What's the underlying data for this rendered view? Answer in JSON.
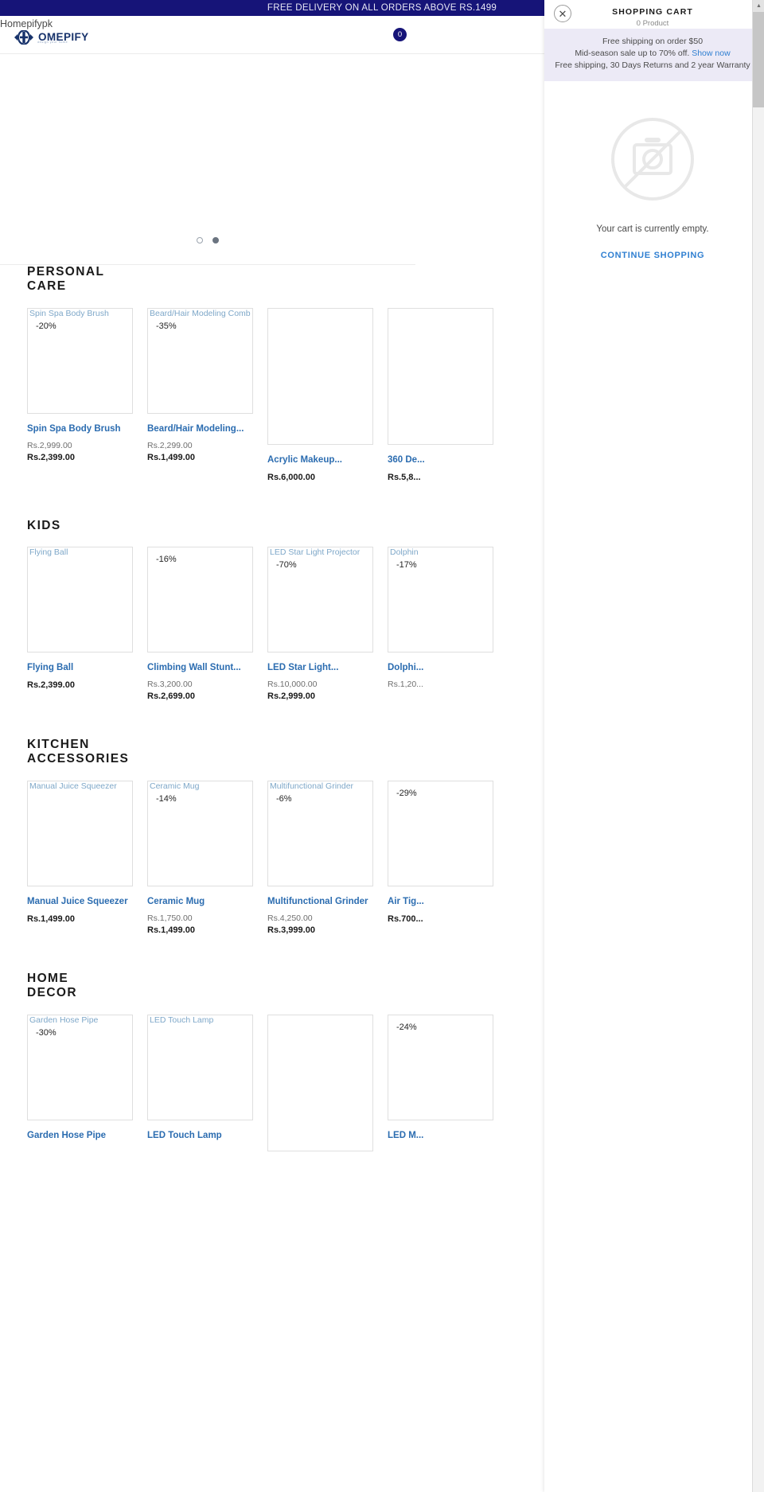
{
  "announcement": {
    "text": "FREE DELIVERY ON ALL ORDERS ABOVE RS.1499"
  },
  "header": {
    "brand_alt_text": "Homepifypk",
    "logo_word": "OMEPIFY",
    "logo_tagline": "design your home",
    "cart_count": "0"
  },
  "cart": {
    "title": "SHOPPING CART",
    "product_count": "0 Product",
    "close_icon": "close-icon",
    "promo_line1": "Free shipping on order  $50",
    "promo_line2_prefix": "Mid-season sale up to 70% off. ",
    "promo_link": "Show now",
    "promo_line3": "Free shipping, 30 Days Returns and 2 year Warranty",
    "empty_text": "Your cart is currently empty.",
    "continue_label": "CONTINUE SHOPPING"
  },
  "collections": [
    {
      "title": "PERSONAL CARE",
      "products": [
        {
          "alt": "Spin Spa Body Brush",
          "discount": "-20%",
          "title": "Spin Spa Body Brush",
          "old_price": "Rs.2,999.00",
          "price": "Rs.2,399.00",
          "tall": false
        },
        {
          "alt": "Beard/Hair Modeling Comb",
          "discount": "-35%",
          "title": "Beard/Hair Modeling...",
          "old_price": "Rs.2,299.00",
          "price": "Rs.1,499.00",
          "tall": false
        },
        {
          "alt": "",
          "discount": "",
          "title": "Acrylic Makeup...",
          "old_price": "",
          "price": "Rs.6,000.00",
          "tall": true
        },
        {
          "alt": "",
          "discount": "",
          "title": "360 De...",
          "old_price": "",
          "price": "Rs.5,8...",
          "tall": true
        }
      ]
    },
    {
      "title": "KIDS",
      "products": [
        {
          "alt": "Flying Ball",
          "discount": "",
          "title": "Flying Ball",
          "old_price": "",
          "price": "Rs.2,399.00",
          "tall": false
        },
        {
          "alt": "",
          "discount": "-16%",
          "title": "Climbing Wall Stunt...",
          "old_price": "Rs.3,200.00",
          "price": "Rs.2,699.00",
          "tall": false
        },
        {
          "alt": "LED Star Light Projector",
          "discount": "-70%",
          "title": "LED Star Light...",
          "old_price": "Rs.10,000.00",
          "price": "Rs.2,999.00",
          "tall": false
        },
        {
          "alt": "Dolphin",
          "discount": "-17%",
          "title": "Dolphi...",
          "old_price": "Rs.1,20...",
          "price": "",
          "tall": false
        }
      ]
    },
    {
      "title": "KITCHEN ACCESSORIES",
      "products": [
        {
          "alt": "Manual Juice Squeezer",
          "discount": "",
          "title": "Manual Juice Squeezer",
          "old_price": "",
          "price": "Rs.1,499.00",
          "tall": false
        },
        {
          "alt": "Ceramic Mug",
          "discount": "-14%",
          "title": "Ceramic Mug",
          "old_price": "Rs.1,750.00",
          "price": "Rs.1,499.00",
          "tall": false
        },
        {
          "alt": "Multifunctional Grinder",
          "discount": "-6%",
          "title": "Multifunctional Grinder",
          "old_price": "Rs.4,250.00",
          "price": "Rs.3,999.00",
          "tall": false
        },
        {
          "alt": "",
          "discount": "-29%",
          "title": "Air Tig...",
          "old_price": "",
          "price": "Rs.700...",
          "tall": false
        }
      ]
    },
    {
      "title": "HOME DECOR",
      "products": [
        {
          "alt": "Garden Hose Pipe",
          "discount": "-30%",
          "title": "Garden Hose Pipe",
          "old_price": "",
          "price": "",
          "tall": false
        },
        {
          "alt": "LED Touch Lamp",
          "discount": "",
          "title": "LED Touch Lamp",
          "old_price": "",
          "price": "",
          "tall": false
        },
        {
          "alt": "",
          "discount": "",
          "title": "",
          "old_price": "",
          "price": "",
          "tall": true
        },
        {
          "alt": "",
          "discount": "-24%",
          "title": "LED M...",
          "old_price": "",
          "price": "",
          "tall": false
        }
      ]
    }
  ],
  "hero": {
    "dots": [
      "inactive",
      "active"
    ]
  },
  "colors": {
    "banner_bg": "#161478",
    "link": "#2b6cb0",
    "promo_bg": "#eceaf6"
  }
}
